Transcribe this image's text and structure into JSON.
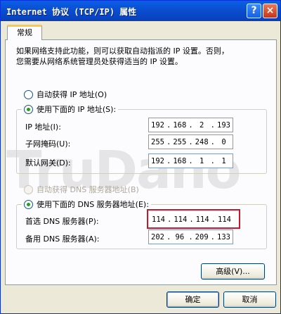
{
  "window": {
    "title": "Internet 协议 (TCP/IP) 属性",
    "help_button": "?",
    "close_button": "×"
  },
  "tab": {
    "label": "常规"
  },
  "description": {
    "line1": "如果网络支持此功能，则可以获取自动指派的 IP 设置。否则，",
    "line2": "您需要从网络系统管理员处获得适当的 IP 设置。"
  },
  "ip_section": {
    "auto_label": "自动获得 IP 地址(O)",
    "manual_label": "使用下面的 IP 地址(S):",
    "selected": "manual",
    "ip_address_label": "IP 地址(I):",
    "ip_address": [
      "192",
      "168",
      "2",
      "193"
    ],
    "subnet_label": "子网掩码(U):",
    "subnet": [
      "255",
      "255",
      "248",
      "0"
    ],
    "gateway_label": "默认网关(D):",
    "gateway": [
      "192",
      "168",
      "1",
      "1"
    ]
  },
  "dns_section": {
    "auto_label": "自动获得 DNS 服务器地址(B)",
    "manual_label": "使用下面的 DNS 服务器地址(E):",
    "selected": "manual",
    "preferred_label": "首选 DNS 服务器(P):",
    "preferred": [
      "114",
      "114",
      "114",
      "114"
    ],
    "alternate_label": "备用 DNS 服务器(A):",
    "alternate": [
      "202",
      "96",
      "209",
      "133"
    ]
  },
  "watermark": {
    "text": "TruDano"
  },
  "buttons": {
    "advanced": "高级(V)...",
    "ok": "确定",
    "cancel": "取消"
  },
  "colors": {
    "titlebar": "#0a4ed0",
    "highlight": "#c8182a",
    "window_bg": "#ece9d8"
  }
}
